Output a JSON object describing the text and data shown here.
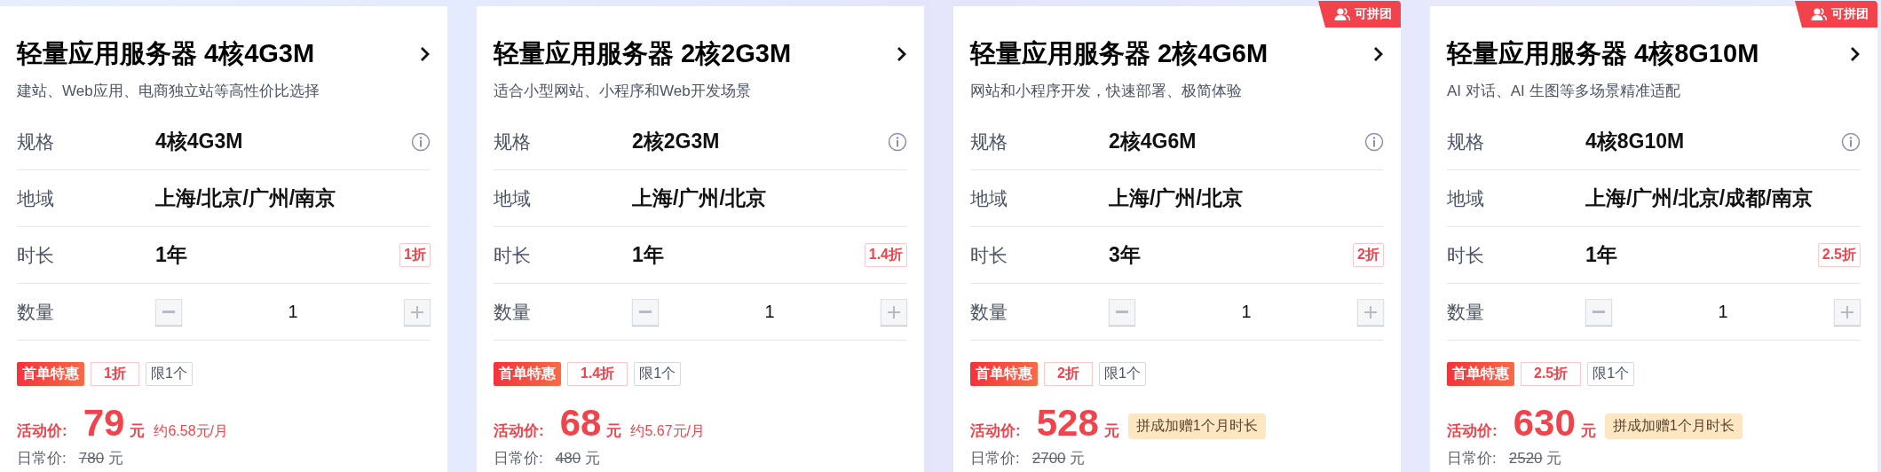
{
  "cards": [
    {
      "title": "轻量应用服务器 4核4G3M",
      "subtitle": "建站、Web应用、电商独立站等高性价比选择",
      "group_buy": false,
      "spec_label": "规格",
      "spec": "4核4G3M",
      "region_label": "地域",
      "region": "上海/北京/广州/南京",
      "duration_label": "时长",
      "duration": "1年",
      "duration_discount": "1折",
      "qty_label": "数量",
      "qty": "1",
      "promo": "首单特惠",
      "promo_discount": "1折",
      "limit": "限1个",
      "price_label": "活动价:",
      "price": "79",
      "price_unit": "元",
      "price_note": {
        "kind": "monthly",
        "text": "约6.58元/月"
      },
      "regular_label": "日常价:",
      "regular_price": "780",
      "regular_unit": "元"
    },
    {
      "title": "轻量应用服务器 2核2G3M",
      "subtitle": "适合小型网站、小程序和Web开发场景",
      "group_buy": false,
      "spec_label": "规格",
      "spec": "2核2G3M",
      "region_label": "地域",
      "region": "上海/广州/北京",
      "duration_label": "时长",
      "duration": "1年",
      "duration_discount": "1.4折",
      "qty_label": "数量",
      "qty": "1",
      "promo": "首单特惠",
      "promo_discount": "1.4折",
      "limit": "限1个",
      "price_label": "活动价:",
      "price": "68",
      "price_unit": "元",
      "price_note": {
        "kind": "monthly",
        "text": "约5.67元/月"
      },
      "regular_label": "日常价:",
      "regular_price": "480",
      "regular_unit": "元"
    },
    {
      "title": "轻量应用服务器 2核4G6M",
      "subtitle": "网站和小程序开发，快速部署、极简体验",
      "group_buy": true,
      "group_buy_label": "可拼团",
      "spec_label": "规格",
      "spec": "2核4G6M",
      "region_label": "地域",
      "region": "上海/广州/北京",
      "duration_label": "时长",
      "duration": "3年",
      "duration_discount": "2折",
      "qty_label": "数量",
      "qty": "1",
      "promo": "首单特惠",
      "promo_discount": "2折",
      "limit": "限1个",
      "price_label": "活动价:",
      "price": "528",
      "price_unit": "元",
      "price_note": {
        "kind": "gift",
        "text": "拼成加赠1个月时长"
      },
      "regular_label": "日常价:",
      "regular_price": "2700",
      "regular_unit": "元"
    },
    {
      "title": "轻量应用服务器 4核8G10M",
      "subtitle": "AI 对话、AI 生图等多场景精准适配",
      "group_buy": true,
      "group_buy_label": "可拼团",
      "spec_label": "规格",
      "spec": "4核8G10M",
      "region_label": "地域",
      "region": "上海/广州/北京/成都/南京",
      "duration_label": "时长",
      "duration": "1年",
      "duration_discount": "2.5折",
      "qty_label": "数量",
      "qty": "1",
      "promo": "首单特惠",
      "promo_discount": "2.5折",
      "limit": "限1个",
      "price_label": "活动价:",
      "price": "630",
      "price_unit": "元",
      "price_note": {
        "kind": "gift",
        "text": "拼成加赠1个月时长"
      },
      "regular_label": "日常价:",
      "regular_price": "2520",
      "regular_unit": "元"
    }
  ]
}
